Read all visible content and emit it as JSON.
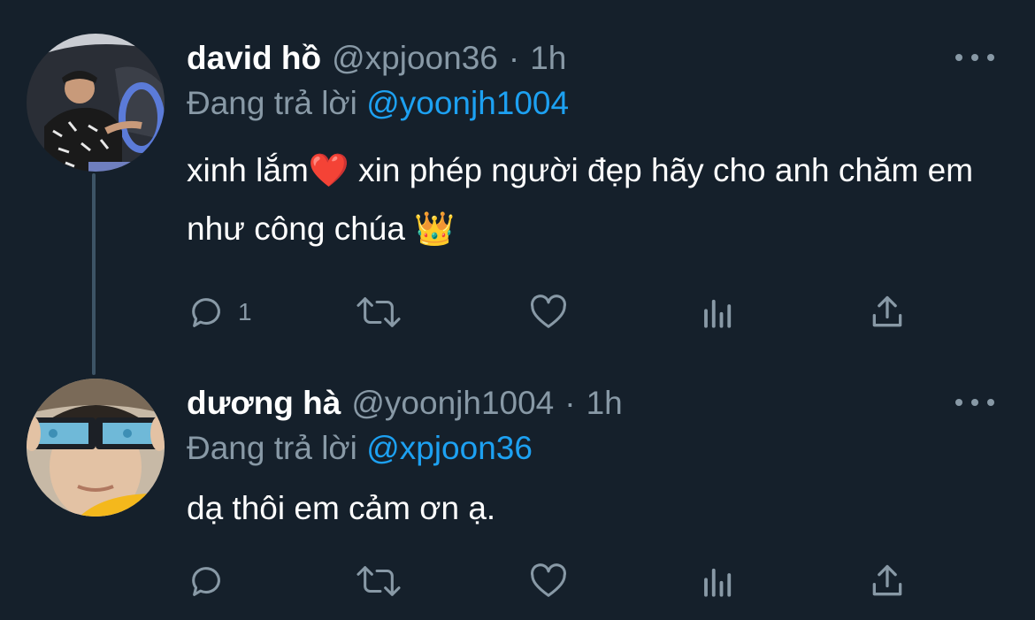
{
  "tweets": [
    {
      "display_name": "david hồ",
      "handle": "@xpjoon36",
      "separator": "·",
      "time": "1h",
      "replying_prefix": "Đang trả lời",
      "replying_to": "@yoonjh1004",
      "text_before_emoji": "xinh lắm",
      "emoji_1": "❤️",
      "text_after_emoji": " xin phép người đẹp hãy cho anh chăm em như công chúa ",
      "emoji_2": "👑",
      "reply_count": "1",
      "avatar_icon": "avatar-man-in-car"
    },
    {
      "display_name": "dương hà",
      "handle": "@yoonjh1004",
      "separator": "·",
      "time": "1h",
      "replying_prefix": "Đang trả lời",
      "replying_to": "@xpjoon36",
      "text": "dạ thôi em cảm ơn ạ.",
      "reply_count": "",
      "avatar_icon": "avatar-person-with-cameras"
    }
  ],
  "colors": {
    "background": "#15202b",
    "secondary_text": "#8899a6",
    "link": "#1da1f2",
    "thread_line": "#3d5466"
  },
  "icons": [
    "reply-icon",
    "retweet-icon",
    "like-icon",
    "stats-icon",
    "share-icon",
    "more-icon"
  ]
}
